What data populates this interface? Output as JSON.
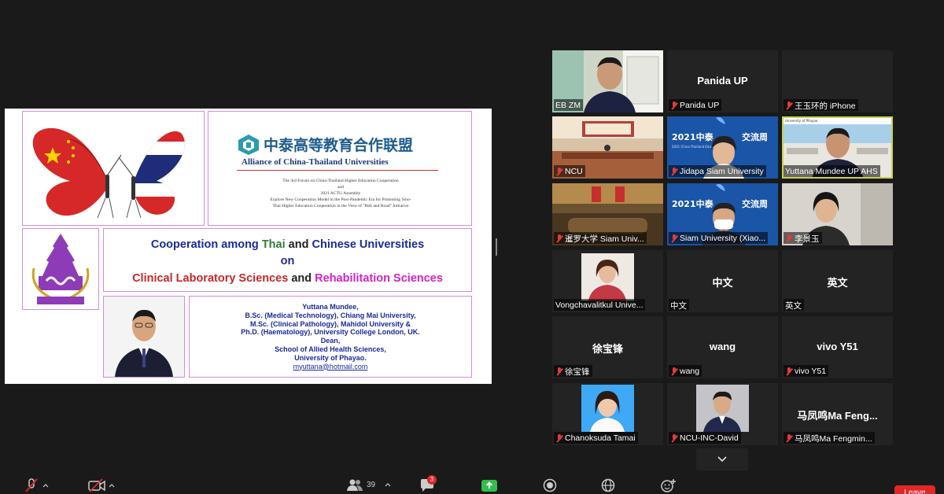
{
  "slide": {
    "alliance_cn": "中泰高等教育合作联盟",
    "alliance_en": "Alliance of China-Thailand Universities",
    "forum_lines": [
      "The 3rd Forum on China-Thailand Higher Education Cooperation",
      "and",
      "2021 ACTU Assembly",
      "Explore New Cooperation Model in the Post-Pandemic Era for Promoting Sino-",
      "Thai Higher Education Cooperation in the View of \"Belt and Road\" Initiative"
    ],
    "title": {
      "w1": "Cooperation among ",
      "w2": "Thai",
      "w3": " and ",
      "w4": "Chinese Universities",
      "line2": "on",
      "w5": "Clinical Laboratory Sciences",
      "w6": " and ",
      "w7": "Rehabilitation Sciences"
    },
    "bio": [
      "Yuttana Mundee,",
      "B.Sc. (Medical Technology), Chiang Mai University,",
      "M.Sc. (Clinical Pathology), Mahidol University &",
      "Ph.D. (Haematology), University College London, UK.",
      "Dean,",
      "School of Allied Health Sciences,",
      "University of Phayao."
    ],
    "email": "myuttana@hotmail.com"
  },
  "gallery": [
    {
      "label": "EB ZM",
      "center": "",
      "muted": false,
      "video": "man-room"
    },
    {
      "label": "Panida UP",
      "center": "Panida UP",
      "muted": true,
      "video": ""
    },
    {
      "label": "王玉环的 iPhone",
      "center": "",
      "muted": true,
      "video": ""
    },
    {
      "label": "NCU",
      "center": "",
      "muted": true,
      "video": "hall"
    },
    {
      "label": "Jidapa Siam University",
      "center": "",
      "muted": true,
      "video": "banner-woman"
    },
    {
      "label": "Yuttana Mundee UP AHS",
      "center": "",
      "muted": false,
      "video": "man-building",
      "active": true
    },
    {
      "label": "暹罗大学 Siam Univ...",
      "center": "",
      "muted": true,
      "video": "meeting-room"
    },
    {
      "label": "Siam University (Xiao...",
      "center": "",
      "muted": true,
      "video": "banner-man"
    },
    {
      "label": "李景玉",
      "center": "",
      "muted": true,
      "video": "woman-office"
    },
    {
      "label": "Vongchavalitkul Unive...",
      "center": "",
      "muted": false,
      "video": "woman-portrait"
    },
    {
      "label": "中文",
      "center": "中文",
      "muted": false,
      "video": ""
    },
    {
      "label": "英文",
      "center": "英文",
      "muted": false,
      "video": ""
    },
    {
      "label": "徐宝锋",
      "center": "徐宝锋",
      "muted": true,
      "video": ""
    },
    {
      "label": "wang",
      "center": "wang",
      "muted": true,
      "video": ""
    },
    {
      "label": "vivo Y51",
      "center": "vivo Y51",
      "muted": true,
      "video": ""
    },
    {
      "label": "Chanoksuda Tamai",
      "center": "",
      "muted": true,
      "video": "woman-id"
    },
    {
      "label": "NCU-INC-David",
      "center": "",
      "muted": true,
      "video": "man-id"
    },
    {
      "label": "马凤鸣Ma Fengmin...",
      "center": "马凤鸣Ma  Feng...",
      "muted": true,
      "video": ""
    }
  ],
  "toolbar": {
    "participants_count": "39",
    "chat_badge": "3",
    "leave_label": "Leave"
  },
  "colors": {
    "background": "#1a1a1a",
    "tile": "#232323",
    "leave": "#e02828",
    "active_speaker": "#c9d24b"
  }
}
